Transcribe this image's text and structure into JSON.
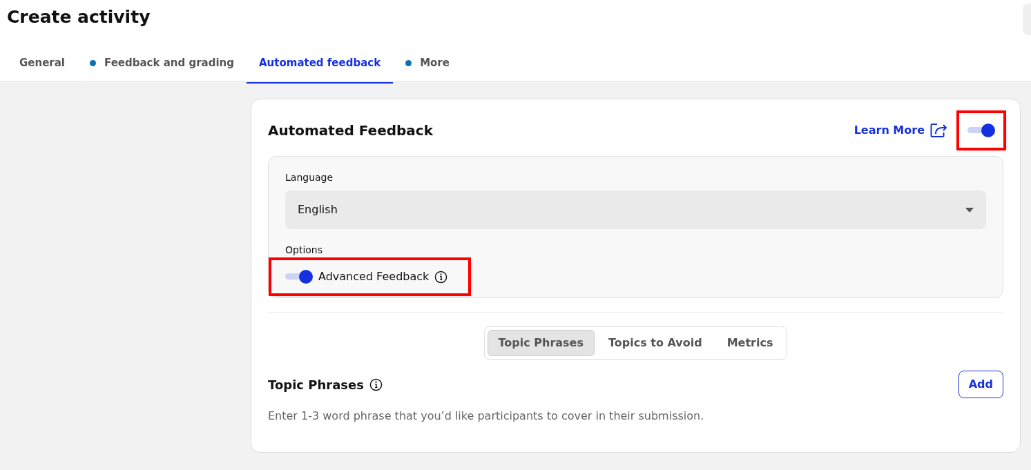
{
  "page_title": "Create activity",
  "tabs": [
    {
      "label": "General",
      "selected": false,
      "dot": false
    },
    {
      "label": "Feedback and grading",
      "selected": false,
      "dot": true
    },
    {
      "label": "Automated feedback",
      "selected": true,
      "dot": false
    },
    {
      "label": "More",
      "selected": false,
      "dot": true
    }
  ],
  "panel": {
    "title": "Automated Feedback",
    "learn_more": "Learn More",
    "enabled": {
      "on": true,
      "highlighted": true
    },
    "language": {
      "label": "Language",
      "value": "English"
    },
    "options": {
      "label": "Options",
      "items": [
        {
          "label": "Advanced Feedback",
          "on": true,
          "highlighted": true
        }
      ]
    },
    "segments": [
      {
        "label": "Topic Phrases",
        "selected": true
      },
      {
        "label": "Topics to Avoid",
        "selected": false
      },
      {
        "label": "Metrics",
        "selected": false
      }
    ],
    "section": {
      "title": "Topic Phrases",
      "add_button": "Add",
      "hint": "Enter 1-3 word phrase that you’d like participants to cover in their submission."
    }
  }
}
